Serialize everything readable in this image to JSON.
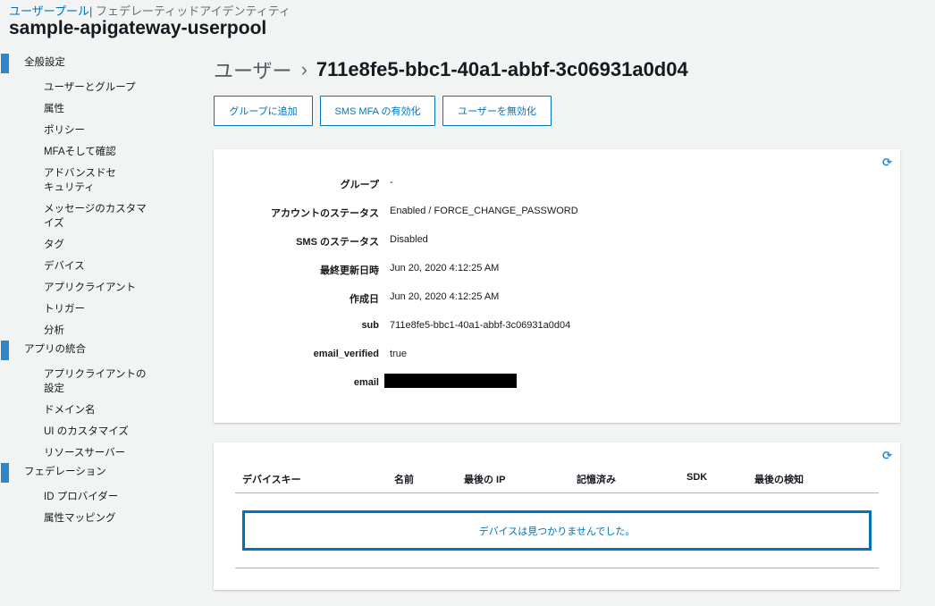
{
  "top_nav": {
    "user_pool": "ユーザープール",
    "separator": "|",
    "federated": "フェデレーティッドアイデンティティ"
  },
  "pool_name": "sample-apigateway-userpool",
  "sidebar": {
    "sections": [
      {
        "label": "全般設定",
        "items": [
          "ユーザーとグループ",
          "属性",
          "ポリシー",
          "MFAそして確認",
          "アドバンスドセキュリティ",
          "メッセージのカスタマイズ",
          "タグ",
          "デバイス",
          "アプリクライアント",
          "トリガー",
          "分析"
        ]
      },
      {
        "label": "アプリの統合",
        "items": [
          "アプリクライアントの設定",
          "ドメイン名",
          "UI のカスタマイズ",
          "リソースサーバー"
        ]
      },
      {
        "label": "フェデレーション",
        "items": [
          "ID プロバイダー",
          "属性マッピング"
        ]
      }
    ]
  },
  "header": {
    "crumb": "ユーザー",
    "chevron": "›",
    "user_id": "711e8fe5-bbc1-40a1-abbf-3c06931a0d04"
  },
  "actions": {
    "add_group": "グループに追加",
    "enable_mfa": "SMS MFA の有効化",
    "disable_user": "ユーザーを無効化"
  },
  "details": [
    {
      "key": "グループ",
      "value": "-"
    },
    {
      "key": "アカウントのステータス",
      "value": "Enabled / FORCE_CHANGE_PASSWORD"
    },
    {
      "key": "SMS のステータス",
      "value": "Disabled"
    },
    {
      "key": "最終更新日時",
      "value": "Jun 20, 2020 4:12:25 AM"
    },
    {
      "key": "作成日",
      "value": "Jun 20, 2020 4:12:25 AM"
    },
    {
      "key": "sub",
      "value": "711e8fe5-bbc1-40a1-abbf-3c06931a0d04"
    },
    {
      "key": "email_verified",
      "value": "true"
    },
    {
      "key": "email",
      "value": ""
    }
  ],
  "devices": {
    "columns": [
      "デバイスキー",
      "名前",
      "最後の IP",
      "記憶済み",
      "SDK",
      "最後の検知"
    ],
    "empty_message": "デバイスは見つかりませんでした。"
  },
  "icons": {
    "refresh": "refresh-icon",
    "chevron": "chevron-right-icon"
  },
  "colors": {
    "accent": "#0073bb",
    "section_bar": "#2e86c9",
    "background": "#f2f3f3"
  }
}
